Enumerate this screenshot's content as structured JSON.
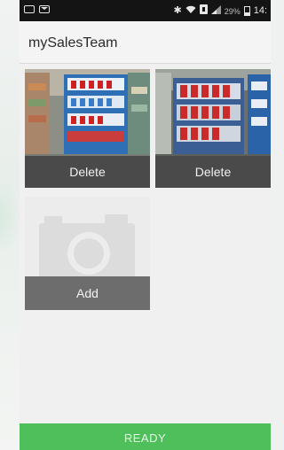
{
  "app": {
    "title": "mySalesTeam"
  },
  "status_bar": {
    "battery_text": "29%",
    "time": "14:"
  },
  "photos": [
    {
      "delete_label": "Delete"
    },
    {
      "delete_label": "Delete"
    }
  ],
  "add_tile": {
    "label": "Add"
  },
  "footer": {
    "ready_label": "READY"
  },
  "colors": {
    "ready_green": "#4fbf5b",
    "overlay_gray": "#4a4a4a",
    "status_black": "#141414"
  },
  "icons": [
    "image-icon",
    "mail-icon",
    "bluetooth-icon",
    "wifi-icon",
    "signal-icon",
    "battery-icon",
    "camera-icon"
  ]
}
